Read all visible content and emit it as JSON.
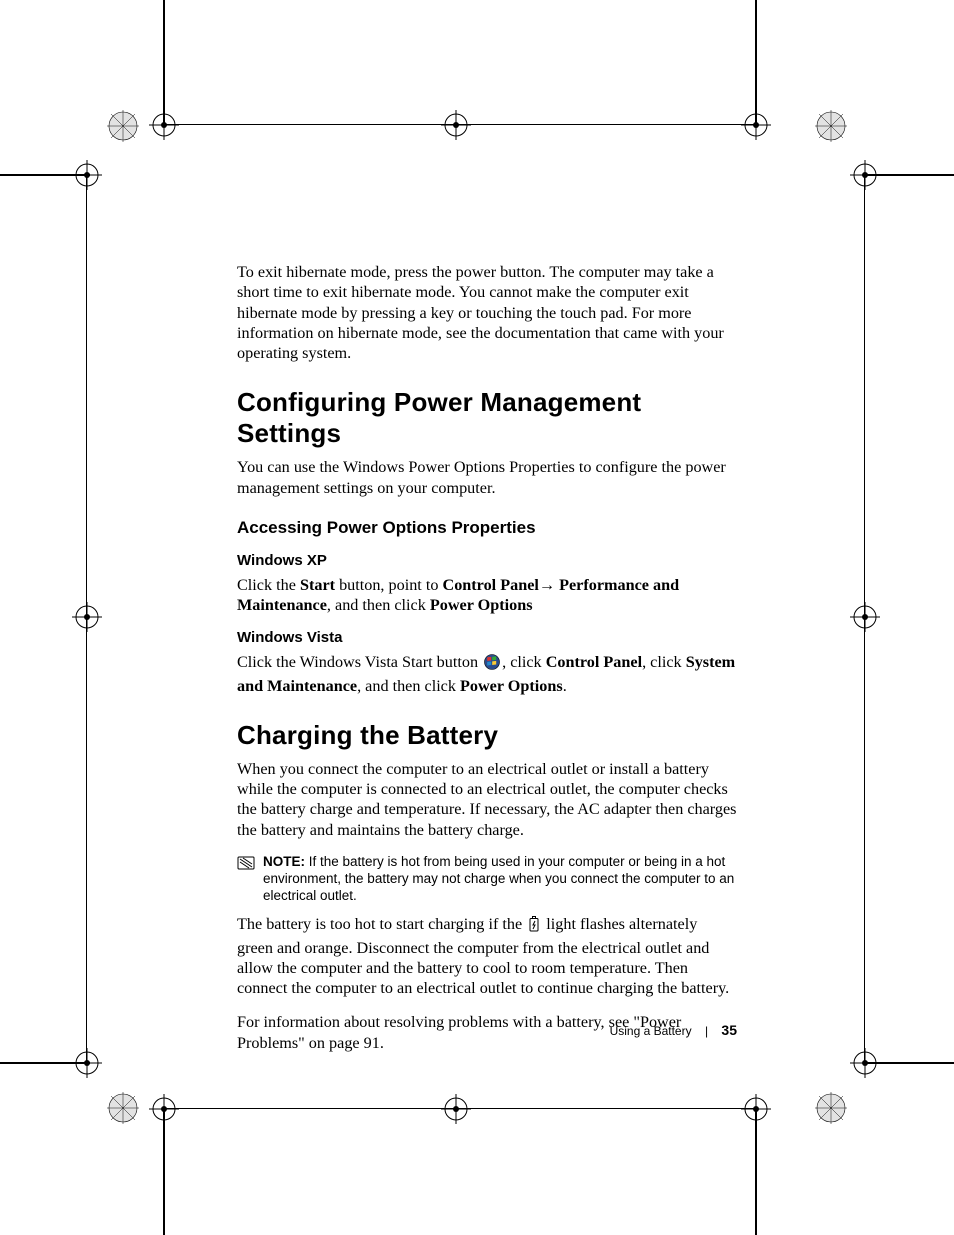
{
  "intro_para": "To exit hibernate mode, press the power button. The computer may take a short time to exit hibernate mode. You cannot make the computer exit hibernate mode by pressing a key or touching the touch pad. For more information on hibernate mode, see the documentation that came with your operating system.",
  "section1": {
    "title": "Configuring Power Management Settings",
    "intro": "You can use the Windows Power Options Properties to configure the power management settings on your computer.",
    "sub_title": "Accessing Power Options Properties",
    "xp_title": "Windows XP",
    "xp_pre": "Click the ",
    "xp_b1": "Start",
    "xp_mid1": " button, point to ",
    "xp_b2": "Control Panel",
    "xp_arrow": "→ ",
    "xp_b3": "Performance and Maintenance",
    "xp_mid2": ", and then click ",
    "xp_b4": "Power Options",
    "vista_title": "Windows Vista",
    "vista_pre": "Click the Windows Vista Start button ",
    "vista_mid1": ", click ",
    "vista_b1": "Control Panel",
    "vista_mid2": ", click ",
    "vista_b2": "System and Maintenance",
    "vista_mid3": ", and then click ",
    "vista_b3": "Power Options",
    "vista_end": "."
  },
  "section2": {
    "title": "Charging the Battery",
    "p1": "When you connect the computer to an electrical outlet or install a battery while the computer is connected to an electrical outlet, the computer checks the battery charge and temperature. If necessary, the AC adapter then charges the battery and maintains the battery charge.",
    "note_label": "NOTE:",
    "note_body": " If the battery is hot from being used in your computer or being in a hot environment, the battery may not charge when you connect the computer to an electrical outlet.",
    "p2_pre": "The battery is too hot to start charging if the ",
    "p2_post": " light flashes alternately green and orange. Disconnect the computer from the electrical outlet and allow the computer and the battery to cool to room temperature. Then connect the computer to an electrical outlet to continue charging the battery.",
    "p3": "For information about resolving problems with a battery, see \"Power Problems\" on page 91."
  },
  "footer": {
    "section": "Using a Battery",
    "page": "35"
  }
}
